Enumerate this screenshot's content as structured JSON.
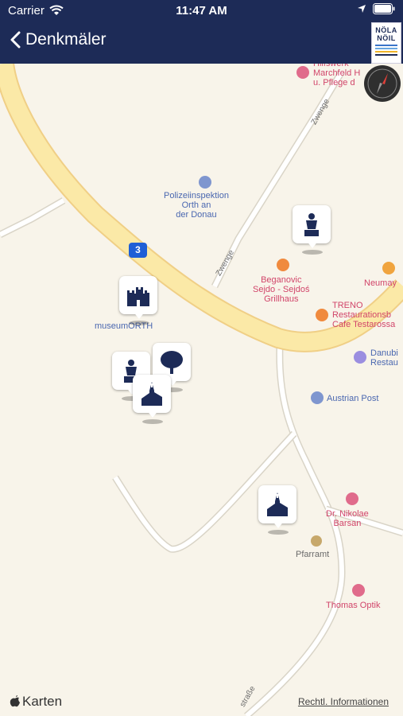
{
  "status": {
    "carrier": "Carrier",
    "time": "11:47 AM"
  },
  "nav": {
    "back_label": "Denkmäler",
    "logo_top": "NÖLA",
    "logo_bottom": "NÖIL"
  },
  "map": {
    "route_number": "3",
    "labels": {
      "police": "Polizeiinspektion\nOrth an\nder Donau",
      "hilfswerk": "Hilfswerk\nMarchfeld H\nu. Pflege d",
      "beganovic": "Beganovic\nSejdo - Sejdoś\nGrillhaus",
      "neumay": "Neumay",
      "treno": "TRENO\nRestaurationsb\nCafe Testarossa",
      "danubi": "Danubi\nRestau",
      "austrian_post": "Austrian Post",
      "dentist": "Dr. Nikolae\nBarsan",
      "pfarramt": "Pfarramt",
      "optik": "Thomas Optik",
      "museum": "museumORTH",
      "street_zwenge_1": "Zwenge",
      "street_zwenge_2": "Zwenge",
      "street_strasse": "straße"
    }
  },
  "footer": {
    "brand": "Karten",
    "legal": "Rechtl. Informationen"
  },
  "colors": {
    "nav_bg": "#1d2b57",
    "map_bg": "#f8f4ea",
    "main_road": "#fbe9a7",
    "marker_icon": "#1d2b57"
  }
}
